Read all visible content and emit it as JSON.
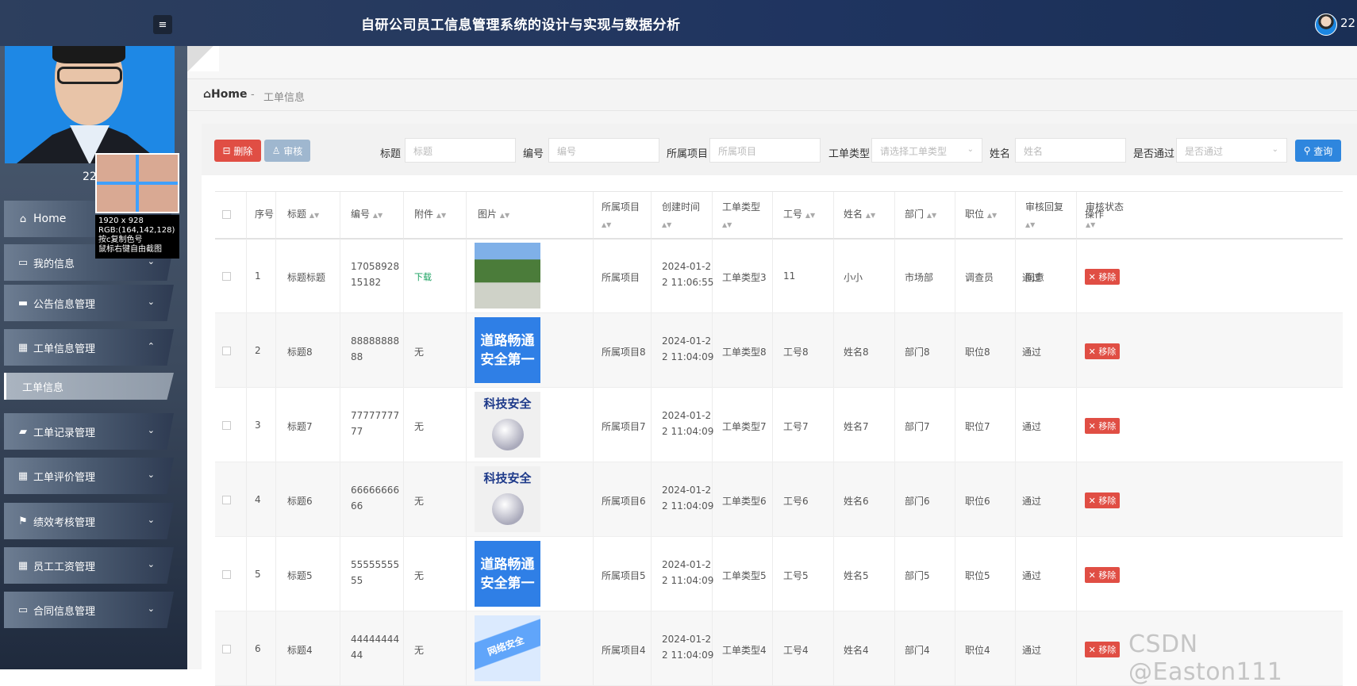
{
  "app": {
    "title": "自研公司员工信息管理系统的设计与实现与数据分析",
    "user": "22",
    "menu_icon": "list-icon"
  },
  "sidebar": {
    "user_label": "22",
    "items": [
      {
        "label": "Home",
        "icon": "home-icon"
      },
      {
        "label": "我的信息",
        "icon": "card-icon"
      },
      {
        "label": "公告信息管理",
        "icon": "printer-icon"
      },
      {
        "label": "工单信息管理",
        "icon": "grid-icon"
      },
      {
        "label": "工单信息",
        "icon": ""
      },
      {
        "label": "工单记录管理",
        "icon": "briefcase-icon"
      },
      {
        "label": "工单评价管理",
        "icon": "grid-icon"
      },
      {
        "label": "绩效考核管理",
        "icon": "flag-icon"
      },
      {
        "label": "员工工资管理",
        "icon": "grid-icon"
      },
      {
        "label": "合同信息管理",
        "icon": "monitor-icon"
      }
    ]
  },
  "picker": {
    "size": "1920 x 928",
    "rgb": "RGB:(164,142,128)",
    "copy_hint": "按c复制色号",
    "shot_hint": "鼠标右键自由截图"
  },
  "breadcrumb": {
    "home": "Home",
    "sep": "-",
    "current": "工单信息"
  },
  "toolbar": {
    "delete_label": "删除",
    "audit_label": "审核",
    "query_label": "查询",
    "filters": [
      {
        "label": "标题",
        "placeholder": "标题"
      },
      {
        "label": "编号",
        "placeholder": "编号"
      },
      {
        "label": "所属项目",
        "placeholder": "所属项目"
      },
      {
        "label": "工单类型",
        "placeholder": "请选择工单类型"
      },
      {
        "label": "姓名",
        "placeholder": "姓名"
      },
      {
        "label": "是否通过",
        "placeholder": "是否通过"
      }
    ]
  },
  "table": {
    "headers": {
      "index": "序号",
      "title": "标题",
      "code": "编号",
      "attachment": "附件",
      "image": "图片",
      "project_a": "所属项目",
      "created_a": "创建时间",
      "type_a": "工单类型",
      "empno": "工号",
      "name": "姓名",
      "dept": "部门",
      "post": "职位",
      "reply_a": "审核回复",
      "status_a": "审核状态",
      "ops": "操作"
    },
    "remove_label": "移除",
    "rows": [
      {
        "index": "1",
        "title": "标题标题",
        "code1": "17058928",
        "code2": "15182",
        "attachment": "下载",
        "project": "所属项目",
        "date1": "2024-01-2",
        "date2": "2 11:06:55",
        "type": "工单类型3",
        "empno": "11",
        "name": "小小",
        "dept": "市场部",
        "post": "调查员",
        "reply": "同意",
        "status": "通过"
      },
      {
        "index": "2",
        "title": "标题8",
        "code1": "88888888",
        "code2": "88",
        "attachment": "无",
        "project": "所属项目8",
        "date1": "2024-01-2",
        "date2": "2 11:04:09",
        "type": "工单类型8",
        "empno": "工号8",
        "name": "姓名8",
        "dept": "部门8",
        "post": "职位8",
        "reply": "",
        "status": "通过",
        "img_text": "道路畅通 安全第一"
      },
      {
        "index": "3",
        "title": "标题7",
        "code1": "77777777",
        "code2": "77",
        "attachment": "无",
        "project": "所属项目7",
        "date1": "2024-01-2",
        "date2": "2 11:04:09",
        "type": "工单类型7",
        "empno": "工号7",
        "name": "姓名7",
        "dept": "部门7",
        "post": "职位7",
        "reply": "",
        "status": "通过",
        "img_text": "科技安全"
      },
      {
        "index": "4",
        "title": "标题6",
        "code1": "66666666",
        "code2": "66",
        "attachment": "无",
        "project": "所属项目6",
        "date1": "2024-01-2",
        "date2": "2 11:04:09",
        "type": "工单类型6",
        "empno": "工号6",
        "name": "姓名6",
        "dept": "部门6",
        "post": "职位6",
        "reply": "",
        "status": "通过",
        "img_text": "科技安全"
      },
      {
        "index": "5",
        "title": "标题5",
        "code1": "55555555",
        "code2": "55",
        "attachment": "无",
        "project": "所属项目5",
        "date1": "2024-01-2",
        "date2": "2 11:04:09",
        "type": "工单类型5",
        "empno": "工号5",
        "name": "姓名5",
        "dept": "部门5",
        "post": "职位5",
        "reply": "",
        "status": "通过",
        "img_text": "道路畅通 安全第一"
      },
      {
        "index": "6",
        "title": "标题4",
        "code1": "44444444",
        "code2": "44",
        "attachment": "无",
        "project": "所属项目4",
        "date1": "2024-01-2",
        "date2": "2 11:04:09",
        "type": "工单类型4",
        "empno": "工号4",
        "name": "姓名4",
        "dept": "部门4",
        "post": "职位4",
        "reply": "",
        "status": "通过",
        "img_text": "网络安全"
      }
    ]
  },
  "watermark": "CSDN @Easton111"
}
